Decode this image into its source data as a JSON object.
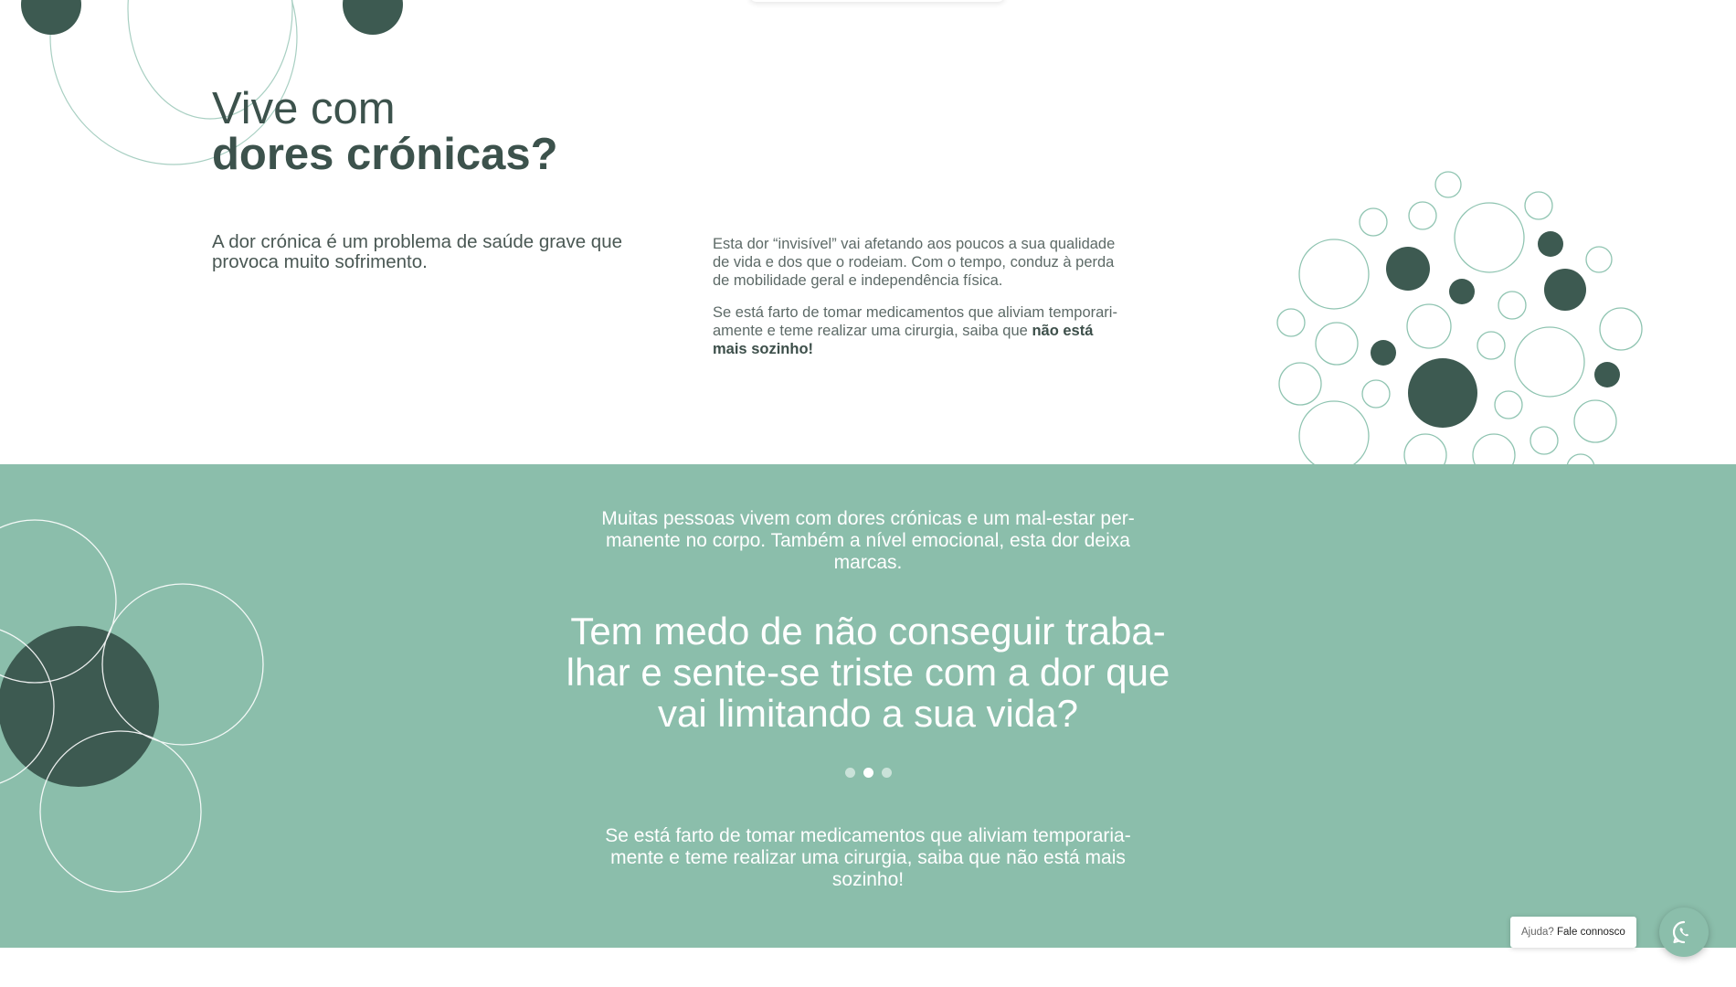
{
  "heading": {
    "line1": "Vive com",
    "line2": "dores crónicas?"
  },
  "intro": "A dor crónica é um problema de saúde grave que provoca muito sofrimento.",
  "description": {
    "p1": "Esta dor “invisível” vai afetando aos poucos a sua qualidade de vida e dos que o rodeiam. Com o tempo, conduz à perda de mobilidade geral e independência física.",
    "p2_start": "Se está farto de tomar medicamentos que aliviam temporari-amente e teme realizar uma cirurgia, saiba que ",
    "p2_bold": "não está mais sozinho!"
  },
  "green": {
    "text1": "Muitas pessoas vivem com dores crónicas e um mal-estar per-manente no corpo. Também a nível emocional, esta dor deixa marcas.",
    "quote": "Tem medo de não conseguir traba-lhar e sente-se triste com a dor que vai limitando a sua vida?",
    "text2": "Se está farto de tomar medicamentos que aliviam temporaria-mente e teme realizar uma cirurgia, saiba que não está mais sozinho!",
    "carousel": {
      "total": 3,
      "active_index": 2
    }
  },
  "help": {
    "prefix": "Ajuda? ",
    "label": "Fale connosco"
  },
  "colors": {
    "dark_green": "#3d5a51",
    "sage": "#8bbeab",
    "text": "#3a4a46"
  },
  "icons": [
    "whatsapp-icon"
  ]
}
